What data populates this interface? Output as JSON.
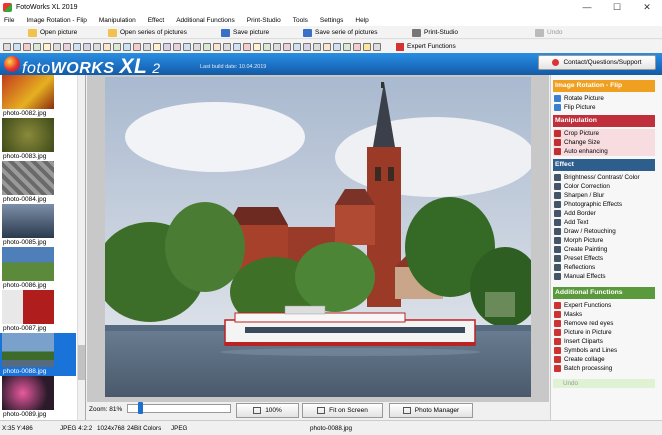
{
  "window": {
    "title": "FotoWorks XL 2019",
    "minimize": "—",
    "maximize": "☐",
    "close": "✕"
  },
  "menu": [
    "File",
    "Image Rotation - Flip",
    "Manipulation",
    "Effect",
    "Additional Functions",
    "Print-Studio",
    "Tools",
    "Settings",
    "Help"
  ],
  "toolbar": {
    "open_picture": "Open picture",
    "open_series": "Open series of pictures",
    "save_picture": "Save picture",
    "save_series": "Save serie of pictures",
    "print_studio": "Print-Studio",
    "undo": "Undo",
    "expert_functions": "Expert Functions"
  },
  "banner": {
    "logo_foto": "foto",
    "logo_works": "WORKS",
    "logo_xl": "XL",
    "logo_version": "2",
    "build_date": "Last build date: 10.04.2019",
    "contact": "Contact/Questions/Support"
  },
  "thumbnails": [
    {
      "label": "photo-0082.jpg",
      "colors": [
        "#c23a1e",
        "#e6b020"
      ]
    },
    {
      "label": "photo-0083.jpg",
      "colors": [
        "#6b7d2a",
        "#3e4a1a"
      ]
    },
    {
      "label": "photo-0084.jpg",
      "colors": [
        "#8c8c8c",
        "#5e5e5e"
      ]
    },
    {
      "label": "photo-0085.jpg",
      "colors": [
        "#2a3a4e",
        "#7d8fa8"
      ]
    },
    {
      "label": "photo-0086.jpg",
      "colors": [
        "#4f7fb8",
        "#3c6b2a"
      ]
    },
    {
      "label": "photo-0087.jpg",
      "colors": [
        "#b01d1d",
        "#e8e8e8"
      ]
    },
    {
      "label": "photo-0088.jpg",
      "colors": [
        "#7aa0cc",
        "#3d6b2a"
      ],
      "selected": true
    },
    {
      "label": "photo-0089.jpg",
      "colors": [
        "#d83a8a",
        "#2a1a2a"
      ]
    }
  ],
  "viewer": {
    "zoom_label": "Zoom: 81%",
    "zoom_level": 0.81,
    "btn_100": "100%",
    "btn_fit": "Fit on Screen",
    "btn_manager": "Photo Manager"
  },
  "sidebar": {
    "sections": [
      {
        "title": "Image Rotation - Flip",
        "color": "#f0a020",
        "bg": "#fff5d8",
        "items": [
          "Rotate Picture",
          "Flip Picture"
        ]
      },
      {
        "title": "Manipulation",
        "color": "#c0303c",
        "bg": "#f8dde0",
        "items": [
          "Crop Picture",
          "Change Size",
          "Auto enhancing"
        ]
      },
      {
        "title": "Effect",
        "color": "#2e5f8c",
        "bg": "#f5f5f5",
        "items": [
          "Brightness/ Contrast/ Color",
          "Color Correction",
          "Sharpen / Blur",
          "Photographic Effects",
          "Add Border",
          "Add Text",
          "Draw / Retouching",
          "Morph Picture",
          "Create Painting",
          "Preset Effects",
          "Reflections",
          "Manual Effects"
        ]
      },
      {
        "title": "Additional Functions",
        "color": "#5a9a3c",
        "bg": "#f5f5f5",
        "items": [
          "Expert Functions",
          "Masks",
          "Remove red eyes",
          "Picture in Picture",
          "Insert Cliparts",
          "Symbols and Lines",
          "Create collage",
          "Batch processing"
        ]
      }
    ],
    "undo": "Undo"
  },
  "status": {
    "coords": "X:35 Y:486",
    "format": "JPEG  4:2:2",
    "dimensions": "1024x768",
    "colors": "24Bit Colors",
    "type": "JPEG",
    "filename": "photo-0088.jpg"
  }
}
